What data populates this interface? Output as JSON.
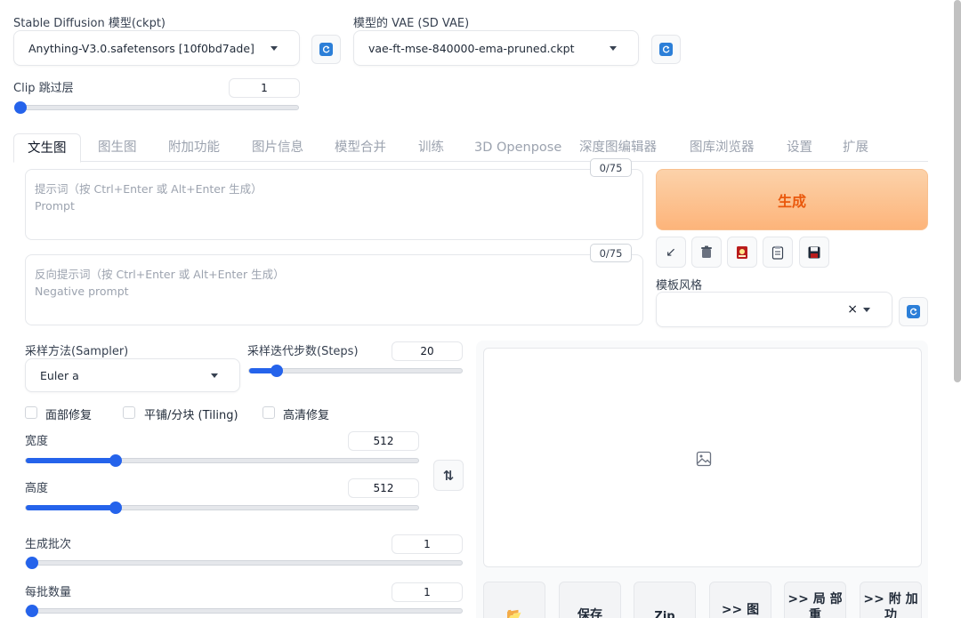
{
  "model": {
    "ckpt_label": "Stable Diffusion 模型(ckpt)",
    "ckpt_value": "Anything-V3.0.safetensors [10f0bd7ade]",
    "vae_label": "模型的 VAE (SD VAE)",
    "vae_value": "vae-ft-mse-840000-ema-pruned.ckpt"
  },
  "clip": {
    "label": "Clip 跳过层",
    "value": "1",
    "level": 0
  },
  "tabs": [
    {
      "label": "文生图",
      "active": true
    },
    {
      "label": "图生图"
    },
    {
      "label": "附加功能"
    },
    {
      "label": "图片信息"
    },
    {
      "label": "模型合并"
    },
    {
      "label": "训练"
    },
    {
      "label": "3D Openpose"
    },
    {
      "label": "深度图编辑器"
    },
    {
      "label": "图库浏览器"
    },
    {
      "label": "设置"
    },
    {
      "label": "扩展"
    }
  ],
  "prompt": {
    "placeholder_line1": "提示词（按 Ctrl+Enter 或 Alt+Enter 生成）",
    "placeholder_line2": "Prompt",
    "counter": "0/75"
  },
  "negative": {
    "placeholder_line1": "反向提示词（按 Ctrl+Enter 或 Alt+Enter 生成）",
    "placeholder_line2": "Negative prompt",
    "counter": "0/75"
  },
  "generate_label": "生成",
  "style": {
    "label": "模板风格",
    "clear": "×"
  },
  "sampler": {
    "label": "采样方法(Sampler)",
    "value": "Euler a"
  },
  "steps": {
    "label": "采样迭代步数(Steps)",
    "value": "20",
    "level": 0.13
  },
  "checkboxes": [
    {
      "label": "面部修复",
      "checked": false
    },
    {
      "label": "平铺/分块 (Tiling)",
      "checked": false
    },
    {
      "label": "高清修复",
      "checked": false
    }
  ],
  "width": {
    "label": "宽度",
    "value": "512",
    "level": 0.23
  },
  "height": {
    "label": "高度",
    "value": "512",
    "level": 0.23
  },
  "batch_count": {
    "label": "生成批次",
    "value": "1",
    "level": 0
  },
  "batch_size": {
    "label": "每批数量",
    "value": "1",
    "level": 0
  },
  "output_buttons": [
    {
      "label": "📂"
    },
    {
      "label": "保存"
    },
    {
      "label": "Zip"
    },
    {
      "label": ">> 图"
    },
    {
      "label": ">> 局 部重"
    },
    {
      "label": ">> 附 加功"
    }
  ],
  "colors": {
    "accent": "#2563eb",
    "generate": "#ea580c",
    "refresh": "#2c7fd8"
  }
}
